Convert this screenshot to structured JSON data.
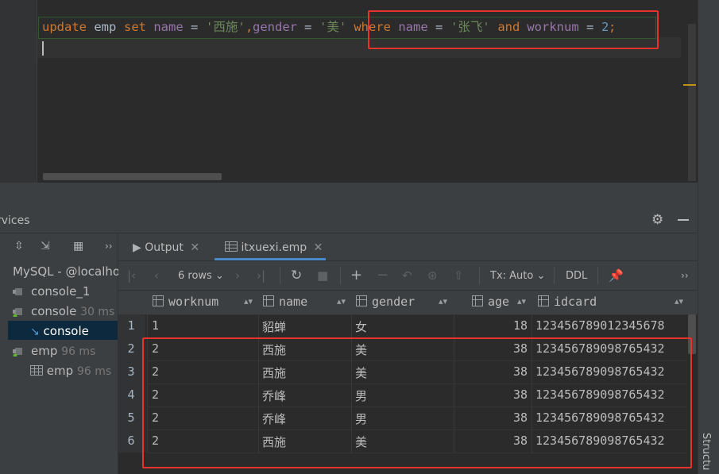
{
  "editor": {
    "tokens": [
      {
        "text": "update",
        "color": "#cc7832"
      },
      {
        "text": " emp ",
        "color": "#a9b7c6"
      },
      {
        "text": "set",
        "color": "#cc7832"
      },
      {
        "text": " name ",
        "color": "#9876aa"
      },
      {
        "text": "= ",
        "color": "#a9b7c6"
      },
      {
        "text": "'西施'",
        "color": "#6a8759"
      },
      {
        "text": ",",
        "color": "#cc7832"
      },
      {
        "text": "gender ",
        "color": "#9876aa"
      },
      {
        "text": "= ",
        "color": "#a9b7c6"
      },
      {
        "text": "'美'",
        "color": "#6a8759"
      },
      {
        "text": " where",
        "color": "#cc7832"
      },
      {
        "text": " name ",
        "color": "#9876aa"
      },
      {
        "text": "= ",
        "color": "#a9b7c6"
      },
      {
        "text": "'张飞'",
        "color": "#6a8759"
      },
      {
        "text": " and",
        "color": "#cc7832"
      },
      {
        "text": " worknum ",
        "color": "#9876aa"
      },
      {
        "text": "= ",
        "color": "#a9b7c6"
      },
      {
        "text": "2",
        "color": "#6897bb"
      },
      {
        "text": ";",
        "color": "#cc7832"
      }
    ]
  },
  "services": {
    "title": "rvices"
  },
  "tree": {
    "items": [
      {
        "label": "MySQL - @localho",
        "meta": ""
      },
      {
        "label": "console_1",
        "meta": ""
      },
      {
        "label": "console",
        "meta": "30 ms"
      },
      {
        "label": "console",
        "meta": ""
      },
      {
        "label": "emp",
        "meta": "96 ms"
      },
      {
        "label": "emp",
        "meta": "96 ms"
      }
    ]
  },
  "tabs": {
    "output": "Output",
    "table": "itxuexi.emp"
  },
  "toolbar": {
    "rows": "6 rows",
    "tx": "Tx: Auto",
    "ddl": "DDL"
  },
  "grid": {
    "columns": [
      "worknum",
      "name",
      "gender",
      "age",
      "idcard"
    ],
    "rows": [
      {
        "n": "1",
        "worknum": "1",
        "name": "貂蝉",
        "gender": "女",
        "age": "18",
        "idcard": "123456789012345678"
      },
      {
        "n": "2",
        "worknum": "2",
        "name": "西施",
        "gender": "美",
        "age": "38",
        "idcard": "123456789098765432"
      },
      {
        "n": "3",
        "worknum": "2",
        "name": "西施",
        "gender": "美",
        "age": "38",
        "idcard": "123456789098765432"
      },
      {
        "n": "4",
        "worknum": "2",
        "name": "乔峰",
        "gender": "男",
        "age": "38",
        "idcard": "123456789098765432"
      },
      {
        "n": "5",
        "worknum": "2",
        "name": "乔峰",
        "gender": "男",
        "age": "38",
        "idcard": "123456789098765432"
      },
      {
        "n": "6",
        "worknum": "2",
        "name": "西施",
        "gender": "美",
        "age": "38",
        "idcard": "123456789098765432"
      }
    ]
  },
  "side": {
    "structure": "Structu"
  },
  "colors": {
    "highlight_box": "#e8332c",
    "selection": "#0d293e"
  }
}
